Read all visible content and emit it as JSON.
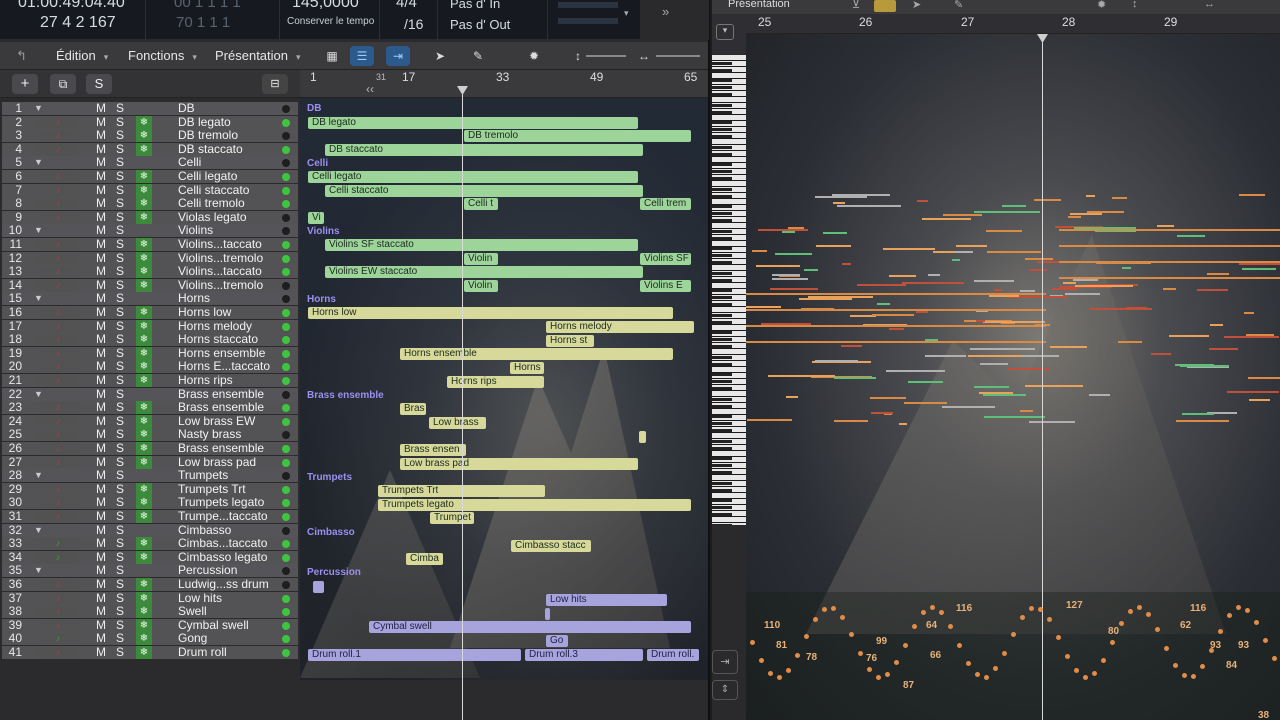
{
  "lcd": {
    "time": "01:00:49:04.40",
    "bars": "27  4  2  167",
    "bpm_top": "00 1  1  1   1",
    "bpm_bottom": "70  1  1  1",
    "tempo": "145,0000",
    "tempo_label": "Conserver le tempo",
    "sig": "4/4",
    "div": "/16",
    "in": "Pas d' In",
    "out": "Pas d' Out"
  },
  "menu": {
    "edition": "Édition",
    "fonctions": "Fonctions",
    "presentation": "Présentation"
  },
  "header": {
    "add": "+",
    "s": "S"
  },
  "ruler": [
    "1",
    "17",
    "33",
    "49",
    "65"
  ],
  "ruler_marker": "31",
  "tracks": [
    {
      "n": "1",
      "name": "DB",
      "folder": true,
      "led": false
    },
    {
      "n": "2",
      "name": "DB legato",
      "led": true
    },
    {
      "n": "3",
      "name": "DB tremolo",
      "led": false
    },
    {
      "n": "4",
      "name": "DB staccato",
      "led": true
    },
    {
      "n": "5",
      "name": "Celli",
      "folder": true,
      "led": false
    },
    {
      "n": "6",
      "name": "Celli legato",
      "led": true
    },
    {
      "n": "7",
      "name": "Celli staccato",
      "led": true
    },
    {
      "n": "8",
      "name": "Celli tremolo",
      "led": true
    },
    {
      "n": "9",
      "name": "Violas legato",
      "led": false
    },
    {
      "n": "10",
      "name": "Violins",
      "folder": true,
      "led": false
    },
    {
      "n": "11",
      "name": "Violins...taccato",
      "led": true
    },
    {
      "n": "12",
      "name": "Violins...tremolo",
      "led": true
    },
    {
      "n": "13",
      "name": "Violins...taccato",
      "led": true
    },
    {
      "n": "14",
      "name": "Violins...tremolo",
      "led": false
    },
    {
      "n": "15",
      "name": "Horns",
      "folder": true,
      "led": false
    },
    {
      "n": "16",
      "name": "Horns low",
      "led": true
    },
    {
      "n": "17",
      "name": "Horns melody",
      "led": true
    },
    {
      "n": "18",
      "name": "Horns staccato",
      "led": true
    },
    {
      "n": "19",
      "name": "Horns ensemble",
      "led": true
    },
    {
      "n": "20",
      "name": "Horns E...taccato",
      "led": true
    },
    {
      "n": "21",
      "name": "Horns rips",
      "led": true
    },
    {
      "n": "22",
      "name": "Brass ensemble",
      "folder": true,
      "led": false
    },
    {
      "n": "23",
      "name": "Brass ensemble",
      "led": true
    },
    {
      "n": "24",
      "name": "Low brass EW",
      "led": true
    },
    {
      "n": "25",
      "name": "Nasty brass",
      "led": false
    },
    {
      "n": "26",
      "name": "Brass ensemble",
      "led": true
    },
    {
      "n": "27",
      "name": "Low brass pad",
      "led": true
    },
    {
      "n": "28",
      "name": "Trumpets",
      "folder": true,
      "led": false
    },
    {
      "n": "29",
      "name": "Trumpets Trt",
      "led": true
    },
    {
      "n": "30",
      "name": "Trumpets legato",
      "led": true
    },
    {
      "n": "31",
      "name": "Trumpe...taccato",
      "led": true
    },
    {
      "n": "32",
      "name": "Cimbasso",
      "folder": true,
      "led": false
    },
    {
      "n": "33",
      "name": "Cimbas...taccato",
      "led": true
    },
    {
      "n": "34",
      "name": "Cimbasso legato",
      "led": true
    },
    {
      "n": "35",
      "name": "Percussion",
      "folder": true,
      "led": false
    },
    {
      "n": "36",
      "name": "Ludwig...ss drum",
      "led": false
    },
    {
      "n": "37",
      "name": "Low hits",
      "led": true
    },
    {
      "n": "38",
      "name": "Swell",
      "led": true
    },
    {
      "n": "39",
      "name": "Cymbal swell",
      "led": true
    },
    {
      "n": "40",
      "name": "Gong",
      "led": true
    },
    {
      "n": "41",
      "name": "Drum roll",
      "led": true
    }
  ],
  "folders": {
    "db": "DB",
    "celli": "Celli",
    "violins": "Violins",
    "horns": "Horns",
    "brass": "Brass ensemble",
    "trumpets": "Trumpets",
    "cimbasso": "Cimbasso",
    "percussion": "Percussion"
  },
  "regions": {
    "db_legato": "DB legato",
    "db_tremolo": "DB tremolo",
    "db_staccato": "DB staccato",
    "celli_legato": "Celli legato",
    "celli_staccato": "Celli staccato",
    "celli_t": "Celli t",
    "celli_trem": "Celli trem",
    "vi": "Vi",
    "vsf": "Violins SF staccato",
    "violin1": "Violin",
    "violins_sf": "Violins SF",
    "vew": "Violins EW staccato",
    "violin2": "Violin",
    "violins_e": "Violins E",
    "horns_low": "Horns low",
    "horns_melody": "Horns melody",
    "horns_st": "Horns st",
    "horns_ens": "Horns ensemble",
    "horns": "Horns",
    "horns_rips": "Horns rips",
    "bras": "Bras",
    "low_brass": "Low brass",
    "brass_ensen": "Brass ensen",
    "low_brass_pad": "Low brass pad",
    "trumpets_trt": "Trumpets Trt",
    "trumpets_legato": "Trumpets legato",
    "trumpet": "Trumpet",
    "cimbasso_stacc": "Cimbasso stacc",
    "cimba": "Cimba",
    "low_hits": "Low hits",
    "cymbal_swell": "Cymbal swell",
    "go": "Go",
    "drum_roll1": "Drum roll.1",
    "drum_roll3": "Drum roll.3",
    "drum_roll": "Drum roll."
  },
  "right": {
    "presentation": "Présentation",
    "ruler": [
      "25",
      "26",
      "27",
      "28",
      "29"
    ]
  },
  "automation_values": [
    "110",
    "81",
    "78",
    "76",
    "99",
    "64",
    "87",
    "66",
    "116",
    "127",
    "80",
    "116",
    "38",
    "93",
    "93",
    "84",
    "62"
  ]
}
